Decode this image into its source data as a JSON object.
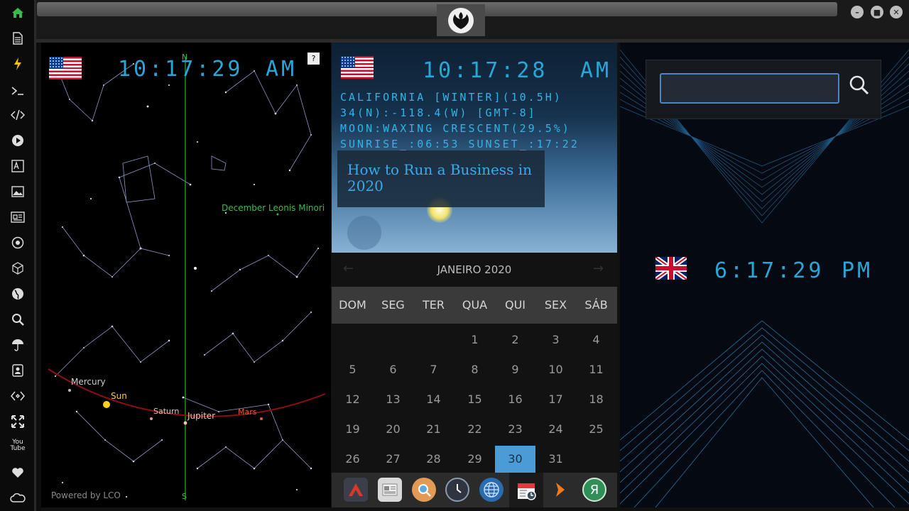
{
  "sidebar": {
    "icons": [
      "home-icon",
      "document-icon",
      "bolt-icon",
      "terminal-icon",
      "code-icon",
      "play-icon",
      "translate-icon",
      "image-icon",
      "news-icon",
      "settings-icon",
      "cube-icon",
      "globe-icon",
      "search-icon",
      "umbrella-icon",
      "contacts-icon",
      "diamond-icon",
      "expand-icon",
      "youtube-icon",
      "heart-icon",
      "cloud-icon"
    ],
    "youtube_label": "You\nTube"
  },
  "colors": {
    "accent": "#2aa6d6",
    "selected": "#4a9bd6",
    "green": "#3fb94f"
  },
  "starchart": {
    "time": "10:17:29",
    "ampm": "AM",
    "help_label": "?",
    "north_label": "N",
    "south_label": "S",
    "meteor_label": "December Leonis Minori",
    "powered_by": "Powered by LCO",
    "planets": {
      "mercury": "Mercury",
      "sun": "Sun",
      "saturn": "Saturn",
      "jupiter": "Jupiter",
      "mars": "Mars"
    }
  },
  "weather": {
    "time": "10:17:28",
    "ampm": "AM",
    "line1": "CALIFORNIA [WINTER](10.5H)",
    "line2": "34(N):-118.4(W) [GMT-8]",
    "line3": "MOON:WAXING CRESCENT(29.5%)",
    "line4": "SUNRISE_:06:53 SUNSET_:17:22",
    "news_title": "How to Run a Business in 2020"
  },
  "calendar": {
    "month": "JANEIRO 2020",
    "prev": "←",
    "next": "→",
    "weekdays": [
      "DOM",
      "SEG",
      "TER",
      "QUA",
      "QUI",
      "SEX",
      "SÁB"
    ],
    "rows": [
      [
        "",
        "",
        "",
        "1",
        "2",
        "3",
        "4"
      ],
      [
        "5",
        "6",
        "7",
        "8",
        "9",
        "10",
        "11"
      ],
      [
        "12",
        "13",
        "14",
        "15",
        "16",
        "17",
        "18"
      ],
      [
        "19",
        "20",
        "21",
        "22",
        "23",
        "24",
        "25"
      ],
      [
        "26",
        "27",
        "28",
        "29",
        "30",
        "31",
        ""
      ]
    ],
    "selected": "30"
  },
  "dock": {
    "items": [
      "arch-icon",
      "newspaper-icon",
      "magnifier-icon",
      "clock-icon",
      "globe-icon",
      "calendar-icon",
      "arrow-icon",
      "yandex-icon"
    ],
    "yandex_label": "Я"
  },
  "uk_clock": {
    "time": "6:17:29",
    "ampm": "PM"
  },
  "search": {
    "value": "",
    "placeholder": ""
  }
}
